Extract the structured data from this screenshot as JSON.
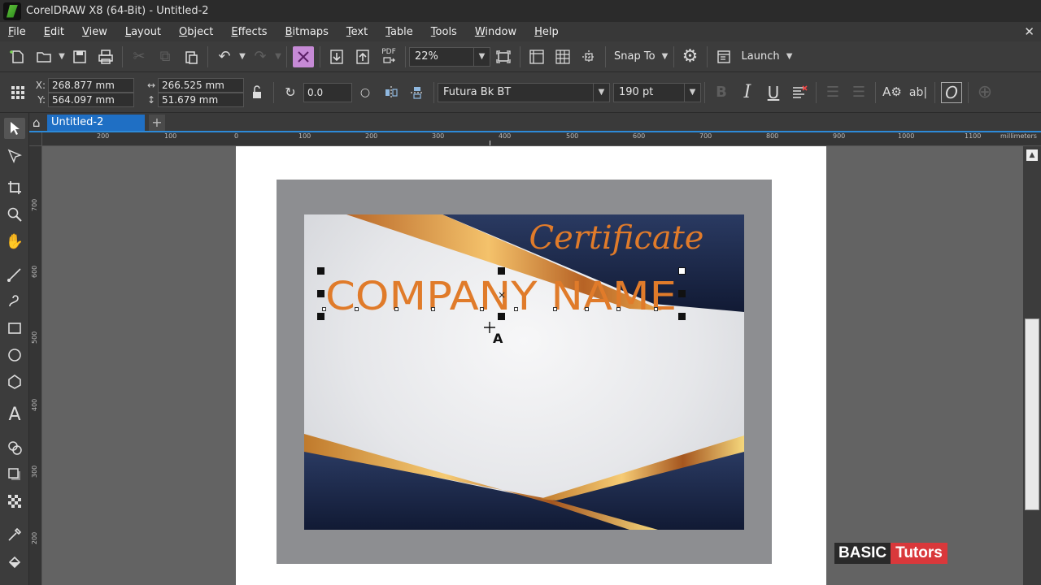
{
  "window": {
    "title": "CorelDRAW X8 (64-Bit) - Untitled-2"
  },
  "menubar": {
    "items": [
      "File",
      "Edit",
      "View",
      "Layout",
      "Object",
      "Effects",
      "Bitmaps",
      "Text",
      "Table",
      "Tools",
      "Window",
      "Help"
    ]
  },
  "toolbar": {
    "zoom": "22%",
    "snap_label": "Snap To",
    "launch_label": "Launch",
    "pdf_label": "PDF"
  },
  "propbar": {
    "x_label": "X:",
    "x_value": "268.877 mm",
    "y_label": "Y:",
    "y_value": "564.097 mm",
    "width_value": "266.525 mm",
    "height_value": "51.679 mm",
    "rotation": "0.0",
    "font_name": "Futura Bk BT",
    "font_size": "190 pt",
    "italic_label": "I",
    "underline_label": "U"
  },
  "tabs": {
    "active": "Untitled-2"
  },
  "ruler": {
    "unit": "millimeters",
    "h_ticks": [
      "200",
      "100",
      "0",
      "100",
      "200",
      "300",
      "400",
      "500",
      "600",
      "700",
      "800",
      "900",
      "1000",
      "1100"
    ],
    "v_ticks": [
      "700",
      "600",
      "500",
      "400",
      "300",
      "200"
    ]
  },
  "document": {
    "certificate_title": "Certificate",
    "company_name": "COMPANY NAME"
  },
  "colors": {
    "accent_orange": "#e07b2a",
    "navy": "#1d2a4c",
    "gold": "#e2a24a",
    "tab_blue": "#1f6fc4"
  },
  "watermark": {
    "part1": "BASIC",
    "part2": "Tutors"
  }
}
